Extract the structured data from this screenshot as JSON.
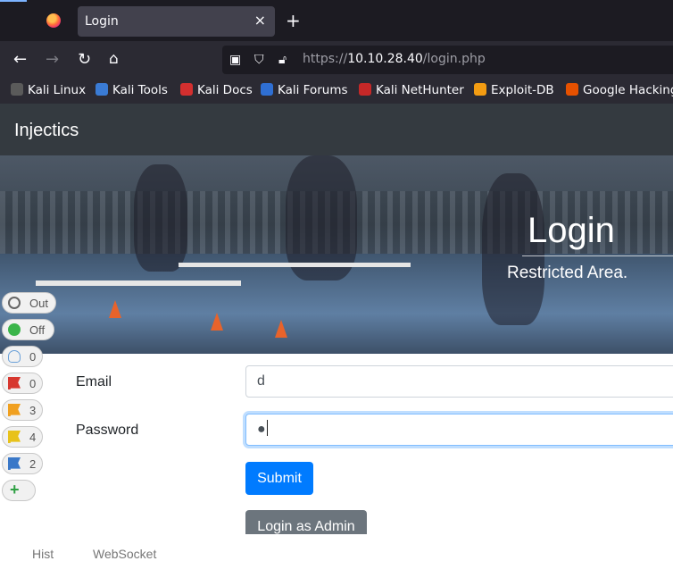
{
  "browser": {
    "tab_title": "Login",
    "tab_close": "×",
    "new_tab": "+",
    "url_protocol": "https://",
    "url_host": "10.10.28.40",
    "url_path": "/login.php",
    "bookmarks": [
      {
        "label": "Kali Linux",
        "color": "#5a5a5a"
      },
      {
        "label": "Kali Tools",
        "color": "#3a7bd5"
      },
      {
        "label": "Kali Docs",
        "color": "#d32f2f"
      },
      {
        "label": "Kali Forums",
        "color": "#2f6fd3"
      },
      {
        "label": "Kali NetHunter",
        "color": "#c62828"
      },
      {
        "label": "Exploit-DB",
        "color": "#f39c12"
      },
      {
        "label": "Google Hacking",
        "color": "#e65100"
      }
    ]
  },
  "site": {
    "brand": "Injectics",
    "hero_title": "Login",
    "hero_subtitle": "Restricted Area."
  },
  "form": {
    "email_label": "Email",
    "email_value": "d",
    "password_label": "Password",
    "password_value": "●",
    "submit_label": "Submit",
    "admin_label": "Login as Admin"
  },
  "overlay": {
    "items": [
      {
        "label": "Out",
        "icon": "target-icon"
      },
      {
        "label": "Off",
        "icon": "status-dot-icon"
      },
      {
        "label": "0",
        "icon": "lightbulb-icon"
      },
      {
        "label": "0",
        "icon": "flag-red-icon"
      },
      {
        "label": "3",
        "icon": "flag-orange-icon"
      },
      {
        "label": "4",
        "icon": "flag-yellow-icon"
      },
      {
        "label": "2",
        "icon": "flag-blue-icon"
      }
    ],
    "add_icon": "plus-icon"
  },
  "bottom": {
    "left_text": "Hist",
    "right_text": "WebSocket"
  },
  "colors": {
    "primary": "#007bff",
    "secondary": "#6c757d",
    "navbar": "#343a40",
    "browser_dark": "#1c1b22"
  }
}
